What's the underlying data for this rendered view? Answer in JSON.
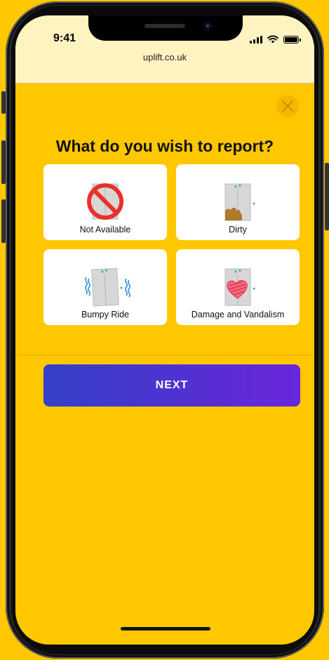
{
  "status_bar": {
    "time": "9:41",
    "url": "uplift.co.uk",
    "icons": [
      "signal-icon",
      "wifi-icon",
      "battery-icon"
    ]
  },
  "dialog": {
    "close_icon": "close-icon",
    "heading": "What do you wish to report?",
    "options": [
      {
        "label": "Not Available",
        "icon": "prohibited-lift-icon"
      },
      {
        "label": "Dirty",
        "icon": "dirty-lift-icon"
      },
      {
        "label": "Bumpy Ride",
        "icon": "shaking-lift-icon"
      },
      {
        "label": "Damage and Vandalism",
        "icon": "vandalised-lift-icon"
      }
    ],
    "next_label": "NEXT"
  },
  "colors": {
    "background": "#FFC700",
    "status_bar_bg": "#FFF3C2",
    "button_gradient_start": "#3440C8",
    "button_gradient_end": "#6A25DA",
    "card_bg": "#FFFFFF"
  }
}
